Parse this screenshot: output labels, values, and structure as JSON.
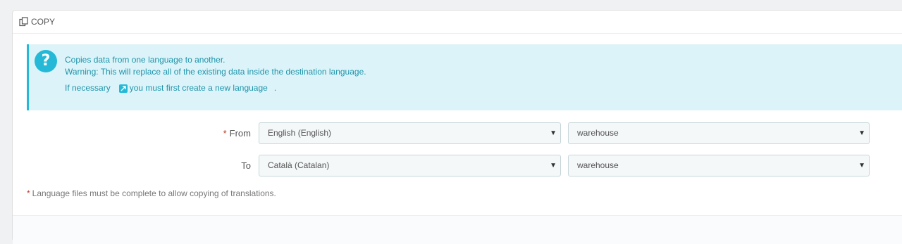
{
  "panel": {
    "title": "Copy"
  },
  "alert": {
    "line1": "Copies data from one language to another.",
    "line2": "Warning: This will replace all of the existing data inside the destination language.",
    "line3_prefix": "If necessary",
    "link_text": "you must first create a new language",
    "line3_suffix": ".",
    "icon": "question-icon"
  },
  "form": {
    "from": {
      "label": "From",
      "required_mark": "*",
      "language": "English (English)",
      "theme": "warehouse"
    },
    "to": {
      "label": "To",
      "language": "Català (Catalan)",
      "theme": "warehouse"
    }
  },
  "footnote": {
    "mark": "*",
    "text": "Language files must be complete to allow copying of translations."
  },
  "colors": {
    "accent": "#25b9d7",
    "alert_bg": "#dcf4f9",
    "required": "#c0392b"
  }
}
